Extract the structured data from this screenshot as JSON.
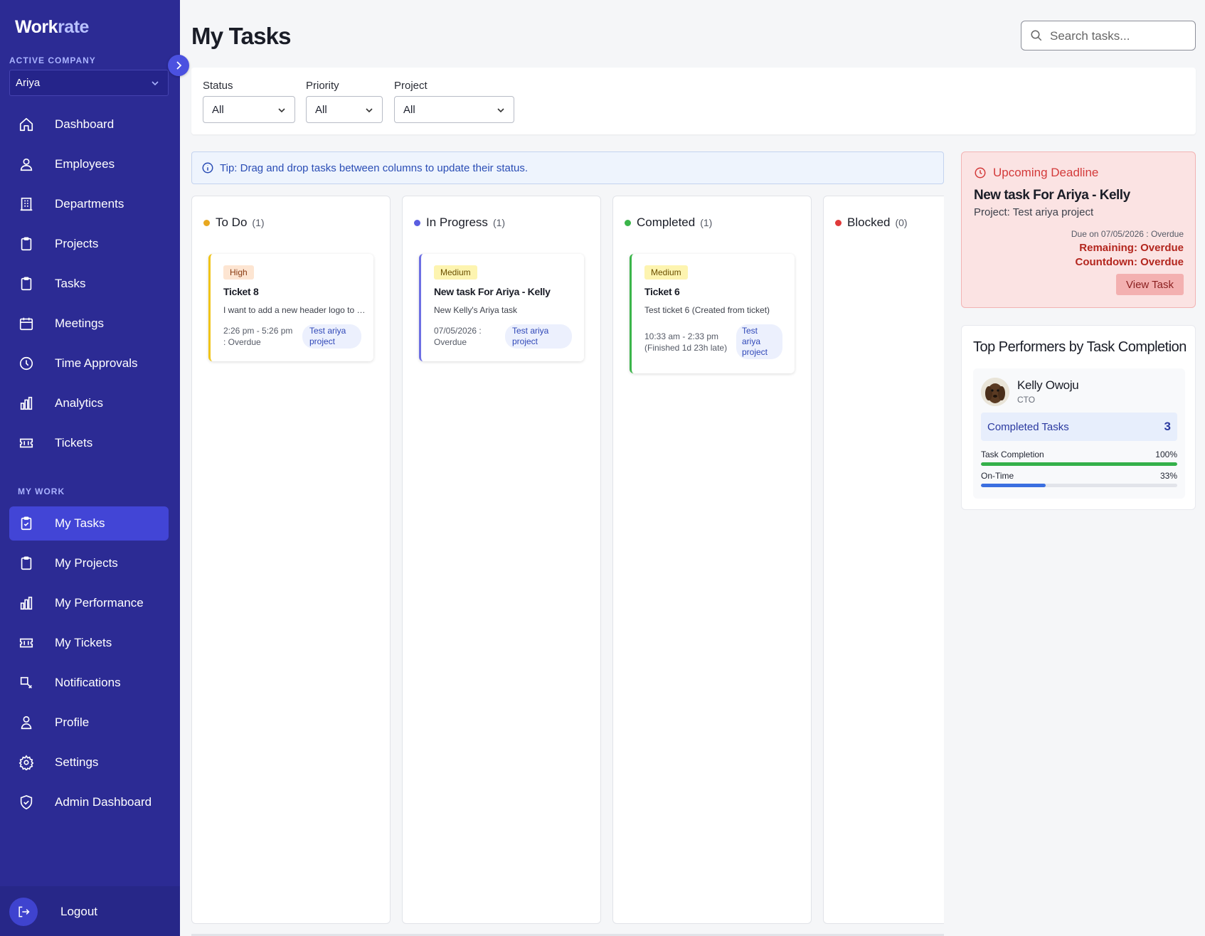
{
  "brand": {
    "part1": "Work",
    "part2": "rate"
  },
  "sidebar": {
    "company_label": "ACTIVE COMPANY",
    "company_value": "Ariya",
    "main_items": [
      {
        "label": "Dashboard",
        "icon": "home-icon"
      },
      {
        "label": "Employees",
        "icon": "users-icon"
      },
      {
        "label": "Departments",
        "icon": "building-icon"
      },
      {
        "label": "Projects",
        "icon": "clipboard-icon"
      },
      {
        "label": "Tasks",
        "icon": "clipboard-icon"
      },
      {
        "label": "Meetings",
        "icon": "calendar-icon"
      },
      {
        "label": "Time Approvals",
        "icon": "clock-icon"
      },
      {
        "label": "Analytics",
        "icon": "bar-chart-icon"
      },
      {
        "label": "Tickets",
        "icon": "ticket-icon"
      }
    ],
    "section_label": "MY WORK",
    "work_items": [
      {
        "label": "My Tasks",
        "icon": "clipboard-check-icon",
        "active": true
      },
      {
        "label": "My Projects",
        "icon": "clipboard-icon"
      },
      {
        "label": "My Performance",
        "icon": "bar-chart-icon"
      },
      {
        "label": "My Tickets",
        "icon": "ticket-icon"
      },
      {
        "label": "Notifications",
        "icon": "bell-edit-icon"
      },
      {
        "label": "Profile",
        "icon": "user-icon"
      },
      {
        "label": "Settings",
        "icon": "gear-icon"
      },
      {
        "label": "Admin Dashboard",
        "icon": "shield-check-icon"
      }
    ],
    "logout_label": "Logout"
  },
  "header": {
    "title": "My Tasks",
    "search_placeholder": "Search tasks..."
  },
  "filters": {
    "status": {
      "label": "Status",
      "value": "All"
    },
    "priority": {
      "label": "Priority",
      "value": "All"
    },
    "project": {
      "label": "Project",
      "value": "All"
    }
  },
  "tip": "Tip: Drag and drop tasks between columns to update their status.",
  "columns": [
    {
      "name": "To Do",
      "count": "(1)",
      "color": "#e8a820"
    },
    {
      "name": "In Progress",
      "count": "(1)",
      "color": "#5a5ee0"
    },
    {
      "name": "Completed",
      "count": "(1)",
      "color": "#3bb54a"
    },
    {
      "name": "Blocked",
      "count": "(0)",
      "color": "#e03a3a"
    }
  ],
  "cards": [
    {
      "priority": "High",
      "title": "Ticket 8",
      "desc": "I want to add a new header logo to the site",
      "time_line1": "2:26 pm - 5:26 pm",
      "time_line2": ": Overdue",
      "tag_line1": "Test ariya",
      "tag_line2": "project",
      "accent": "#f0c419"
    },
    {
      "priority": "Medium",
      "title": "New task For Ariya - Kelly",
      "desc": "New Kelly's Ariya task",
      "time_line1": "07/05/2026 :",
      "time_line2": "Overdue",
      "tag_line1": "Test ariya",
      "tag_line2": "project",
      "accent": "#6d6fe3"
    },
    {
      "priority": "Medium",
      "title": "Ticket 6",
      "desc": "Test ticket 6 (Created from ticket)",
      "time_line1": "10:33 am - 2:33 pm",
      "time_line2": "(Finished 1d 23h late)",
      "tag_line1": "Test",
      "tag_line2": "ariya",
      "tag_line3": "project",
      "accent": "#3bb54a"
    }
  ],
  "deadline": {
    "heading": "Upcoming Deadline",
    "title": "New task For Ariya - Kelly",
    "project": "Project: Test ariya project",
    "due": "Due on 07/05/2026 : Overdue",
    "remaining": "Remaining: Overdue",
    "countdown": "Countdown: Overdue",
    "button": "View Task"
  },
  "performers": {
    "title": "Top Performers by Task Completion",
    "name": "Kelly Owoju",
    "role": "CTO",
    "completed_label": "Completed Tasks",
    "completed_value": "3",
    "task_completion_label": "Task Completion",
    "task_completion_value": "100%",
    "task_completion_fraction": 1.0,
    "on_time_label": "On-Time",
    "on_time_value": "33%",
    "on_time_fraction": 0.33
  }
}
